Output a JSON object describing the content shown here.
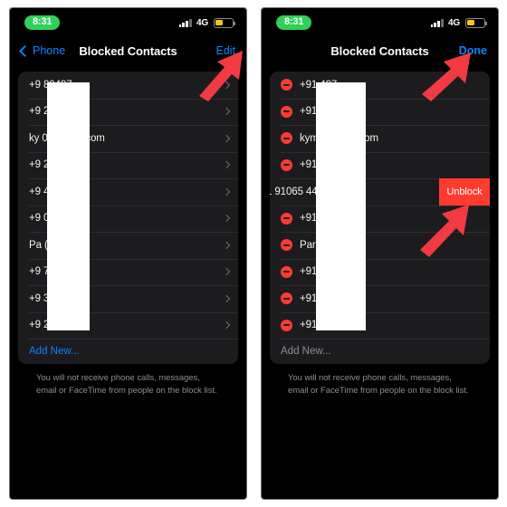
{
  "meta": {
    "accent_blue": "#0a84ff",
    "accent_red": "#ff3b30",
    "green_pill": "#30d158",
    "list_bg": "#1c1c1e",
    "arrow_color": "#f23a42"
  },
  "panels": [
    {
      "id": "left",
      "status": {
        "time": "8:31",
        "network": "4G",
        "signal_icon": "cellular-bars-icon",
        "battery_icon": "battery-low-power-icon"
      },
      "nav": {
        "back_label": "Phone",
        "back_icon": "chevron-left-icon",
        "title": "Blocked Contacts",
        "action_label": "Edit"
      },
      "rows": [
        {
          "label": "+9                80497",
          "chevron": true,
          "editing": false
        },
        {
          "label": "+9                2674",
          "chevron": true,
          "editing": false
        },
        {
          "label": "ky             0@gmail.com",
          "chevron": true,
          "editing": false
        },
        {
          "label": "+9                2636",
          "chevron": true,
          "editing": false
        },
        {
          "label": "+9                4796",
          "chevron": true,
          "editing": false
        },
        {
          "label": "+9                0002",
          "chevron": true,
          "editing": false
        },
        {
          "label": "Pa           (mobile)",
          "chevron": true,
          "editing": false
        },
        {
          "label": "+9                7183",
          "chevron": true,
          "editing": false
        },
        {
          "label": "+9                3539",
          "chevron": true,
          "editing": false
        },
        {
          "label": "+9                2168",
          "chevron": true,
          "editing": false
        }
      ],
      "add_new_label": "Add New...",
      "footer_note": "You will not receive phone calls, messages, email or FaceTime from people on the block list."
    },
    {
      "id": "right",
      "status": {
        "time": "8:31",
        "network": "4G",
        "signal_icon": "cellular-bars-icon",
        "battery_icon": "battery-low-power-icon"
      },
      "nav": {
        "back_label": "",
        "back_icon": "",
        "title": "Blocked Contacts",
        "action_label": "Done"
      },
      "rows": [
        {
          "label": "+91                497",
          "editing": true,
          "swiped": false
        },
        {
          "label": "+91                674",
          "editing": true,
          "swiped": false
        },
        {
          "label": "kym             @gmail.com",
          "editing": true,
          "swiped": false
        },
        {
          "label": "+91                636",
          "editing": true,
          "swiped": false
        },
        {
          "label": "1 91065 44",
          "editing": false,
          "swiped": true,
          "action_label": "Unblock"
        },
        {
          "label": "+91                002",
          "editing": true,
          "swiped": false
        },
        {
          "label": "Par            (mobile)",
          "editing": true,
          "swiped": false
        },
        {
          "label": "+91                 83",
          "editing": true,
          "swiped": false
        },
        {
          "label": "+91                539",
          "editing": true,
          "swiped": false
        },
        {
          "label": "+91                 68",
          "editing": true,
          "swiped": false
        }
      ],
      "add_new_label": "Add New...",
      "footer_note": "You will not receive phone calls, messages, email or FaceTime from people on the block list."
    }
  ],
  "annotations": {
    "arrow_edit": "points-to-edit-button",
    "arrow_done": "points-to-done-button",
    "arrow_unblock": "points-to-unblock-button"
  }
}
